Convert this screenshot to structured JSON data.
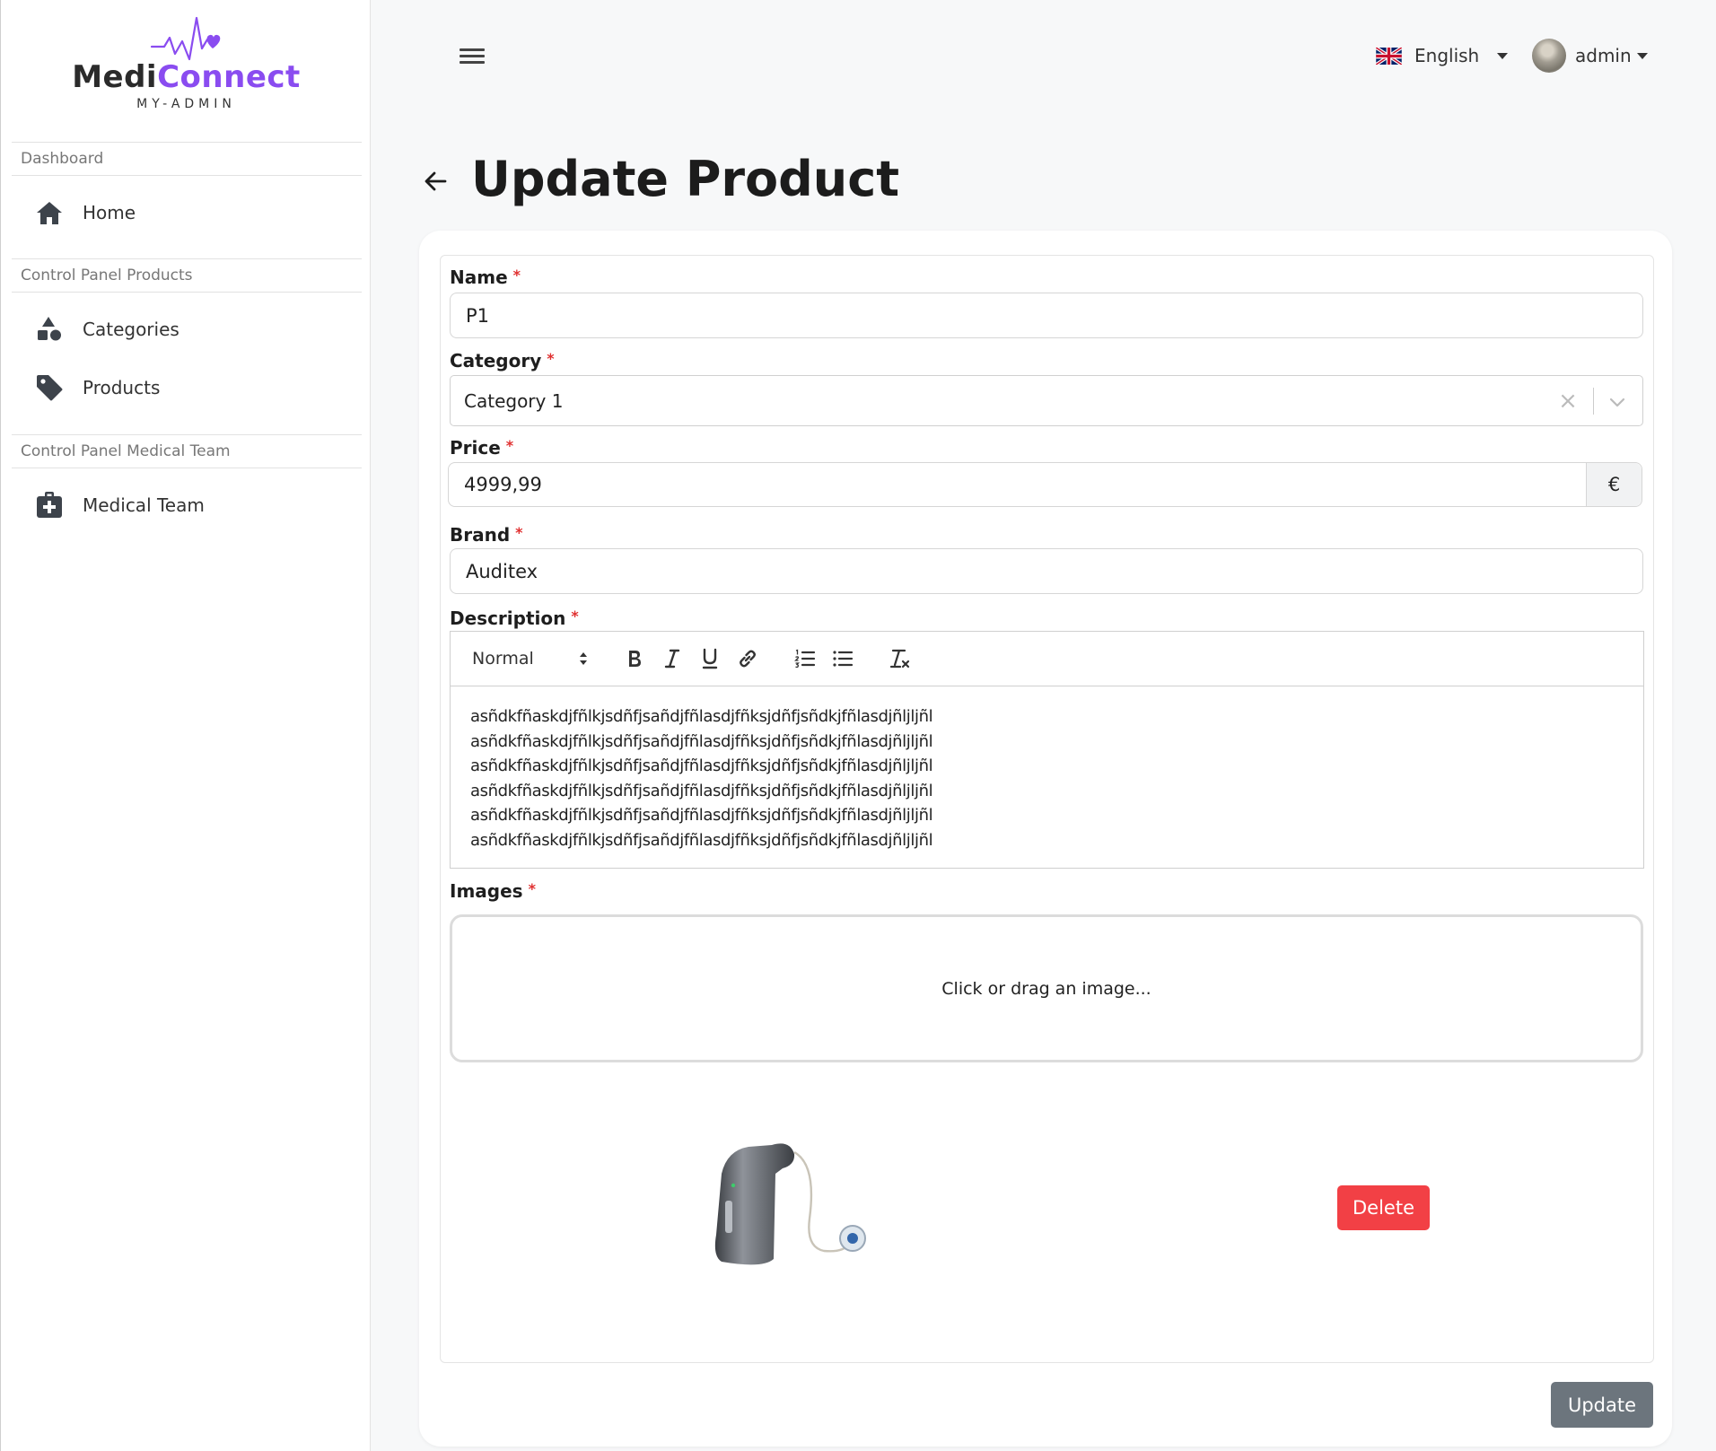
{
  "brand": {
    "name_part1": "Medi",
    "name_part2": "Connect",
    "subtitle": "MY-ADMIN",
    "accent_color": "#8a4cf0"
  },
  "sidebar": {
    "sections": [
      {
        "title": "Dashboard",
        "items": [
          {
            "label": "Home",
            "icon": "home-icon"
          }
        ]
      },
      {
        "title": "Control Panel Products",
        "items": [
          {
            "label": "Categories",
            "icon": "shapes-icon"
          },
          {
            "label": "Products",
            "icon": "tag-icon"
          }
        ]
      },
      {
        "title": "Control Panel Medical Team",
        "items": [
          {
            "label": "Medical Team",
            "icon": "medical-kit-icon"
          }
        ]
      }
    ]
  },
  "topbar": {
    "language": "English",
    "language_flag": "uk-flag-icon",
    "user": "admin"
  },
  "page": {
    "title": "Update Product"
  },
  "form": {
    "required_mark": "*",
    "name": {
      "label": "Name",
      "value": "P1"
    },
    "category": {
      "label": "Category",
      "value": "Category 1"
    },
    "price": {
      "label": "Price",
      "value": "4999,99",
      "currency": "€"
    },
    "brand": {
      "label": "Brand",
      "value": "Auditex"
    },
    "description": {
      "label": "Description",
      "format": "Normal",
      "lines": [
        "asñdkfñaskdjfñlkjsdñfjsañdjfñlasdjfñksjdñfjsñdkjfñlasdjñljljñl",
        "asñdkfñaskdjfñlkjsdñfjsañdjfñlasdjfñksjdñfjsñdkjfñlasdjñljljñl",
        "asñdkfñaskdjfñlkjsdñfjsañdjfñlasdjfñksjdñfjsñdkjfñlasdjñljljñl",
        "asñdkfñaskdjfñlkjsdñfjsañdjfñlasdjfñksjdñfjsñdkjfñlasdjñljljñl",
        "asñdkfñaskdjfñlkjsdñfjsañdjfñlasdjfñksjdñfjsñdkjfñlasdjñljljñl",
        "asñdkfñaskdjfñlkjsdñfjsañdjfñlasdjfñksjdñfjsñdkjfñlasdjñljljñl"
      ]
    },
    "images": {
      "label": "Images",
      "dropzone_text": "Click or drag an image...",
      "delete_label": "Delete"
    },
    "submit_label": "Update"
  }
}
